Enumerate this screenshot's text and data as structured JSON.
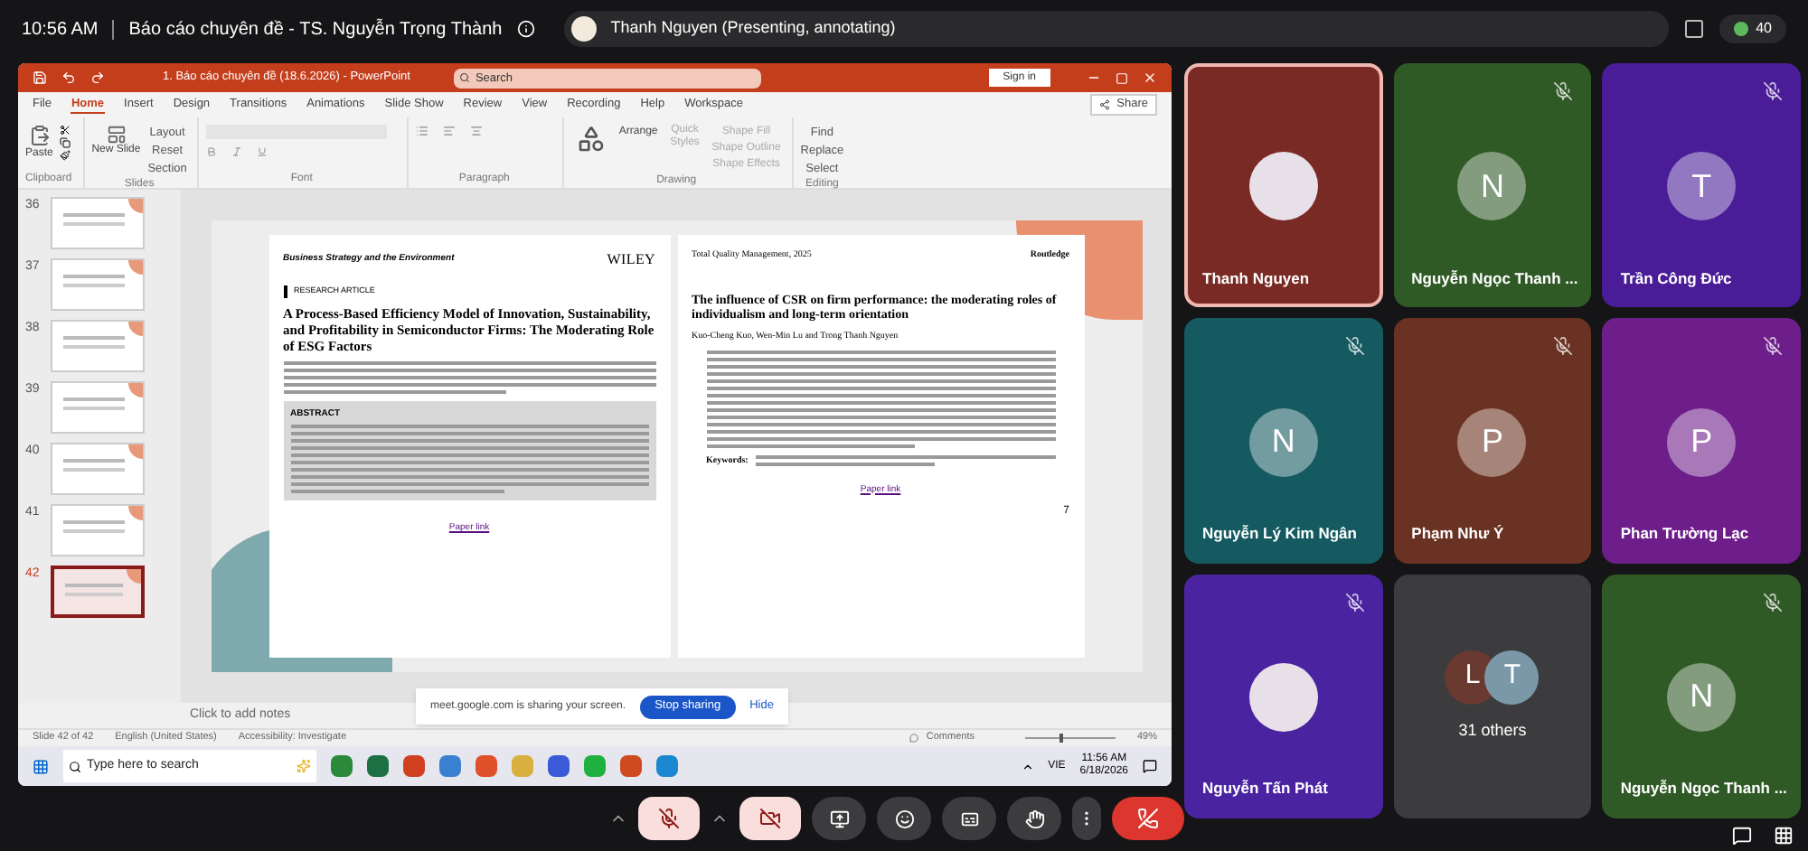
{
  "meeting": {
    "time": "10:56 AM",
    "title": "Báo cáo chuyên đề - TS. Nguyễn Trọng Thành",
    "presenter": "Thanh Nguyen (Presenting, annotating)",
    "participant_count": "40"
  },
  "powerpoint": {
    "title": "1. Báo cáo chuyên đề (18.6.2026) - PowerPoint",
    "search": {
      "placeholder": "Search"
    },
    "sign_in": "Sign in",
    "tabs": [
      {
        "label": "File",
        "selected": false
      },
      {
        "label": "Home",
        "selected": true
      },
      {
        "label": "Insert",
        "selected": false
      },
      {
        "label": "Design",
        "selected": false
      },
      {
        "label": "Transitions",
        "selected": false
      },
      {
        "label": "Animations",
        "selected": false
      },
      {
        "label": "Slide Show",
        "selected": false
      },
      {
        "label": "Review",
        "selected": false
      },
      {
        "label": "View",
        "selected": false
      },
      {
        "label": "Recording",
        "selected": false
      },
      {
        "label": "Help",
        "selected": false
      },
      {
        "label": "Workspace",
        "selected": false
      }
    ],
    "share": "Share",
    "ribbon": {
      "paste": "Paste",
      "new_slide": "New Slide",
      "slide_commands": [
        "Layout",
        "Reset",
        "Section"
      ],
      "arrange": "Arrange",
      "quick_styles": "Quick Styles",
      "shape_commands": [
        "Shape Fill",
        "Shape Outline",
        "Shape Effects"
      ],
      "editing_commands": [
        "Find",
        "Replace",
        "Select"
      ],
      "groups": [
        "Clipboard",
        "Slides",
        "Font",
        "Paragraph",
        "Drawing",
        "Editing"
      ]
    },
    "thumbnails": [
      {
        "number": "36",
        "selected": false
      },
      {
        "number": "37",
        "selected": false
      },
      {
        "number": "38",
        "selected": false
      },
      {
        "number": "39",
        "selected": false
      },
      {
        "number": "40",
        "selected": false
      },
      {
        "number": "41",
        "selected": false
      },
      {
        "number": "42",
        "selected": true
      }
    ],
    "slide": {
      "left_paper": {
        "journal": "Business Strategy and the Environment",
        "publisher": "WILEY",
        "section": "RESEARCH ARTICLE",
        "title": "A Process-Based Efficiency Model of Innovation, Sustainability, and Profitability in Semiconductor Firms: The Moderating Role of ESG Factors",
        "abstract_heading": "ABSTRACT",
        "link": "Paper link"
      },
      "right_paper": {
        "journal": "Total Quality Management, 2025",
        "publisher": "Routledge",
        "title": "The influence of CSR on firm performance: the moderating roles of individualism and long-term orientation",
        "authors": "Kuo-Cheng Kuo, Wen-Min Lu and Trong Thanh Nguyen",
        "keywords_label": "Keywords:",
        "link": "Paper link",
        "page": "7"
      }
    },
    "notes_placeholder": "Click to add notes",
    "status_bar": [
      "Slide 42 of 42",
      "English (United States)",
      "Accessibility: Investigate"
    ],
    "comments": "Comments",
    "zoom": "49%",
    "zoom_slider": {
      "level": 0.4
    },
    "sharing_banner": {
      "message": "meet.google.com is sharing your screen.",
      "stop": "Stop sharing",
      "hide": "Hide"
    },
    "taskbar": {
      "search": {
        "placeholder": "Type here to search"
      },
      "language": "VIE",
      "time": "11:56 AM",
      "date": "6/18/2026"
    }
  },
  "participants": [
    {
      "kind": "photo",
      "name": "Thanh Nguyen",
      "color": "#7a2a24",
      "muted": false,
      "speaking": true
    },
    {
      "kind": "letter",
      "name": "Nguyễn Ngọc Thanh ...",
      "initial": "N",
      "color": "#2f5a26",
      "muted": true,
      "speaking": false
    },
    {
      "kind": "letter",
      "name": "Trần Công Đức",
      "initial": "T",
      "color": "#4a1c98",
      "muted": true,
      "speaking": false
    },
    {
      "kind": "letter",
      "name": "Nguyễn Lý Kim Ngân",
      "initial": "N",
      "color": "#145a60",
      "muted": true,
      "speaking": false
    },
    {
      "kind": "letter",
      "name": "Phạm Như Ý",
      "initial": "P",
      "color": "#6a3222",
      "muted": true,
      "speaking": false
    },
    {
      "kind": "letter",
      "name": "Phan Trường Lạc",
      "initial": "P",
      "color": "#6e1e8a",
      "muted": true,
      "speaking": false
    },
    {
      "kind": "photo",
      "name": "Nguyễn Tấn Phát",
      "color": "#4a24a0",
      "muted": true,
      "speaking": false
    },
    {
      "kind": "others",
      "label": "31 others",
      "avatars": [
        {
          "initial": "L",
          "color": "#6a3a30"
        },
        {
          "initial": "T",
          "color": "#7a98a8"
        }
      ]
    },
    {
      "kind": "letter",
      "name": "Nguyễn Ngọc Thanh ...",
      "initial": "N",
      "color": "#2f5a26",
      "muted": true,
      "speaking": false
    }
  ],
  "controls": {
    "microphone_on": false,
    "camera_on": false
  }
}
